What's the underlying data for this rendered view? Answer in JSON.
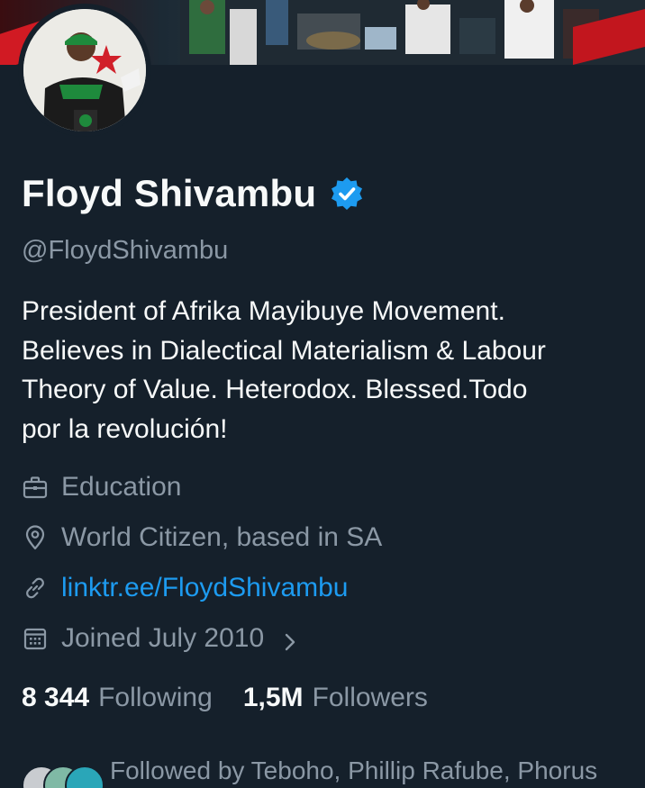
{
  "profile": {
    "display_name": "Floyd Shivambu",
    "handle": "@FloydShivambu",
    "verified": true,
    "bio_lines": [
      "President of Afrika Mayibuye Movement.",
      "Believes in Dialectical Materialism & Labour",
      "Theory of Value. Heterodox. Blessed.Todo",
      "por la revolución!"
    ],
    "category": "Education",
    "location": "World Citizen, based in SA",
    "website": "linktr.ee/FloydShivambu",
    "joined": "Joined July 2010"
  },
  "stats": {
    "following_count": "8 344",
    "following_label": "Following",
    "followers_count": "1,5M",
    "followers_label": "Followers"
  },
  "followed_by": {
    "text": "Followed by Teboho, Phillip Rafube, Phorus"
  },
  "icons": {
    "verified": "verified-badge-icon",
    "category": "briefcase-icon",
    "location": "location-pin-icon",
    "website": "link-icon",
    "joined": "calendar-icon",
    "expand": "chevron-right-icon"
  },
  "colors": {
    "background": "#15202b",
    "text": "#f7f9f9",
    "secondary_text": "#8b98a5",
    "accent": "#1d9bf0"
  }
}
